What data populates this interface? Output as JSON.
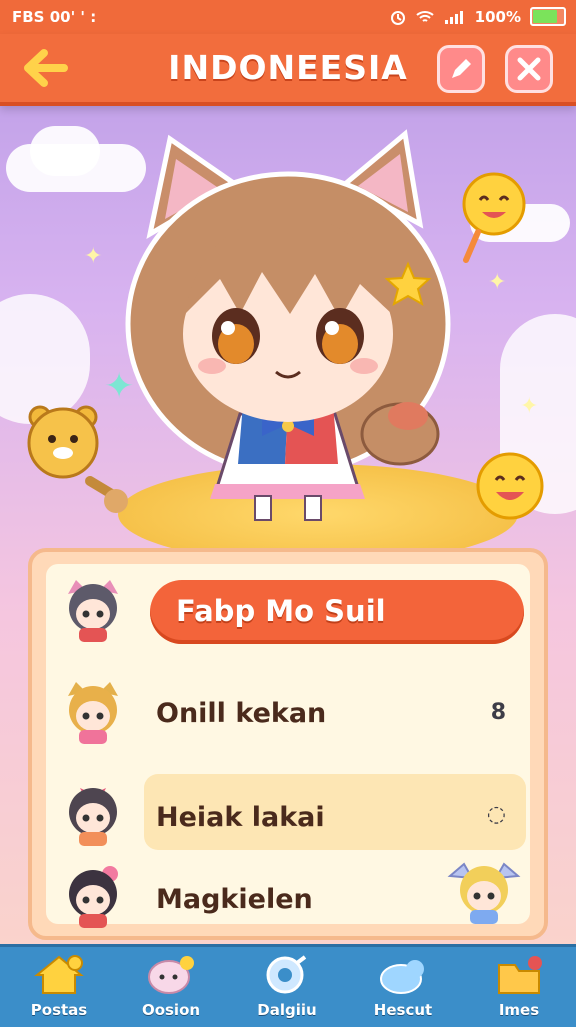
{
  "status": {
    "left_text": "FBS 00' ' :",
    "battery_text": "100%",
    "battery_level": 0.85
  },
  "header": {
    "title": "INDONEESIA",
    "back_icon": "arrow-left-icon",
    "edit_icon": "pencil-icon",
    "close_icon": "close-icon"
  },
  "menu": {
    "items": [
      {
        "label": "Fabp Mo Suil",
        "active": true,
        "trailing": ""
      },
      {
        "label": "Onill kekan",
        "active": false,
        "trailing": "8"
      },
      {
        "label": "Heiak lakai",
        "active": false,
        "trailing": "◌"
      },
      {
        "label": "Magkielen",
        "active": false,
        "trailing": ""
      }
    ]
  },
  "nav": {
    "items": [
      {
        "label": "Postas",
        "icon": "house-icon"
      },
      {
        "label": "Oosion",
        "icon": "chat-icon"
      },
      {
        "label": "Dalgiiu",
        "icon": "search-icon"
      },
      {
        "label": "Hescut",
        "icon": "cloud-icon"
      },
      {
        "label": "Imes",
        "icon": "folder-icon"
      }
    ]
  },
  "colors": {
    "header": "#f26d3d",
    "active": "#f3643a",
    "nav": "#3b8ec9",
    "panel": "#ffd9b8"
  }
}
